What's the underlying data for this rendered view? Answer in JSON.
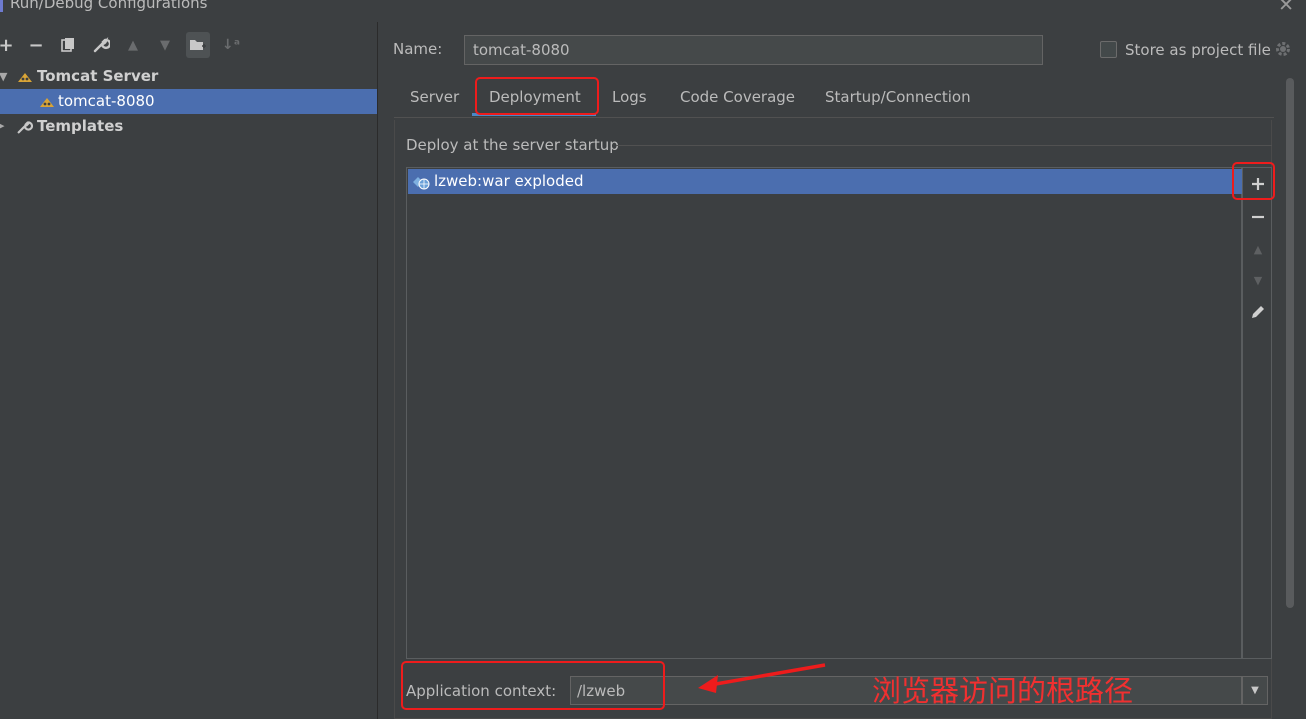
{
  "window": {
    "title": "Run/Debug Configurations"
  },
  "toolbar": {
    "icons": [
      "add-icon",
      "remove-icon",
      "copy-icon",
      "wrench-icon",
      "move-up-icon",
      "move-down-icon",
      "folder-icon",
      "sort-icon"
    ]
  },
  "tree": {
    "group": "Tomcat Server",
    "item": "tomcat-8080",
    "templates": "Templates"
  },
  "form": {
    "name_label": "Name:",
    "name_value": "tomcat-8080",
    "store_label": "Store as project file",
    "store_checked": false
  },
  "tabs": [
    {
      "label": "Server"
    },
    {
      "label": "Deployment",
      "active": true
    },
    {
      "label": "Logs"
    },
    {
      "label": "Code Coverage"
    },
    {
      "label": "Startup/Connection"
    }
  ],
  "deploy": {
    "section_title": "Deploy at the server startup",
    "items": [
      {
        "label": "lzweb:war exploded",
        "selected": true
      }
    ]
  },
  "context": {
    "label": "Application context:",
    "value": "/lzweb"
  },
  "annotation": {
    "text": "浏览器访问的根路径"
  },
  "colors": {
    "background": "#3c3f41",
    "selection": "#4b6eaf",
    "highlight": "#ee1c1c",
    "tab_underline": "#4a88c7"
  }
}
